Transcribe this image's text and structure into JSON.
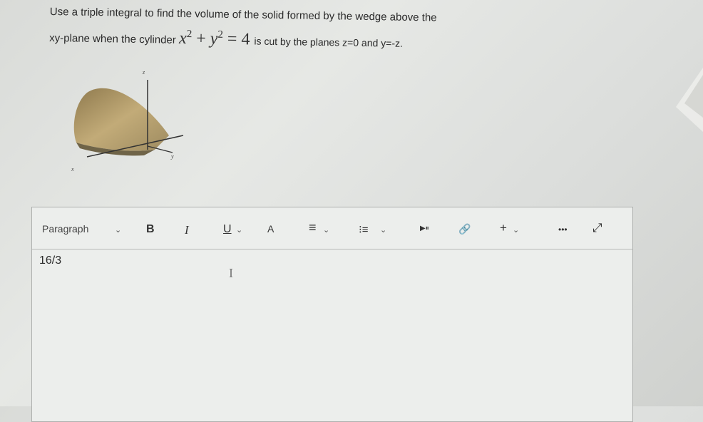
{
  "question": {
    "line1": "Use a triple integral to find the volume of the solid formed by the wedge above the",
    "line2_prefix": "xy-plane when the cylinder",
    "equation": {
      "x": "x",
      "y": "y",
      "exp": "2",
      "plus": "+",
      "eq": "=",
      "rhs": "4"
    },
    "line2_suffix": "is cut by the planes z=0 and y=-z."
  },
  "figure": {
    "axis_labels": {
      "z": "z",
      "y": "y",
      "x": "x"
    },
    "colors": {
      "surface_top": "#b59d6c",
      "surface_shadow": "#8a7a56",
      "axis": "#333333"
    }
  },
  "toolbar": {
    "paragraph_label": "Paragraph",
    "chevron": "⌄",
    "bold": "B",
    "italic": "I",
    "underline": "U",
    "text_color": "A",
    "align": "≡",
    "list": "⁝≡",
    "media": "▶⏸",
    "link": "🔗",
    "insert": "+",
    "more": "•••",
    "fullscreen": "⤢"
  },
  "editor": {
    "content": "16/3",
    "cursor": "I"
  }
}
